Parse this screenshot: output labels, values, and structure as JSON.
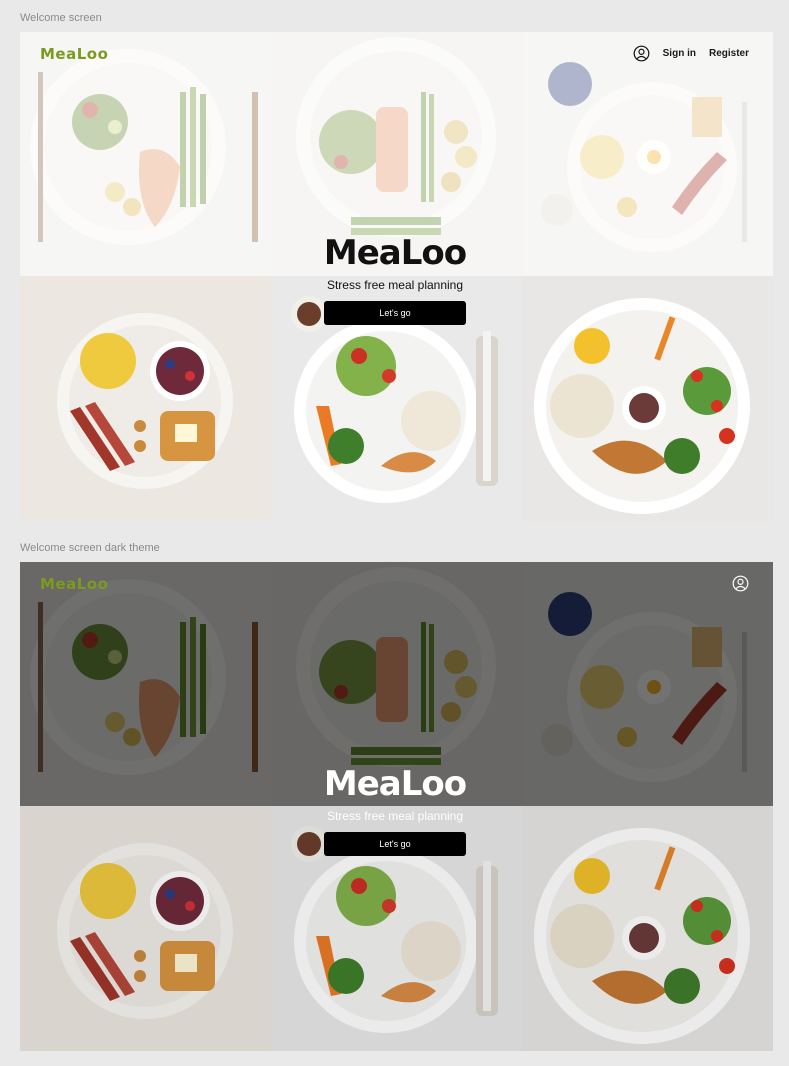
{
  "frames": [
    {
      "label": "Welcome screen",
      "theme": "light",
      "brand": "MeaLoo",
      "nav": {
        "sign_in": "Sign in",
        "register": "Register"
      },
      "hero": {
        "title": "MeaLoo",
        "subtitle": "Stress free meal planning",
        "cta": "Let's go"
      }
    },
    {
      "label": "Welcome screen dark theme",
      "theme": "dark",
      "brand": "MeaLoo",
      "hero": {
        "title": "MeaLoo",
        "subtitle": "Stress free meal planning",
        "cta": "Let's go"
      }
    }
  ],
  "colors": {
    "brand": "#7c9a1d",
    "cta_bg": "#000000",
    "cta_text": "#ffffff",
    "canvas": "#e9e9e9"
  },
  "icons": [
    "user-icon"
  ],
  "tiles": [
    "salmon-potato-plate",
    "salmon-asparagus-plate",
    "egg-bacon-breakfast-plate",
    "scrambled-egg-berries-toast-plate",
    "chicken-rice-salad-plate",
    "rice-chicken-vegetable-plate"
  ]
}
